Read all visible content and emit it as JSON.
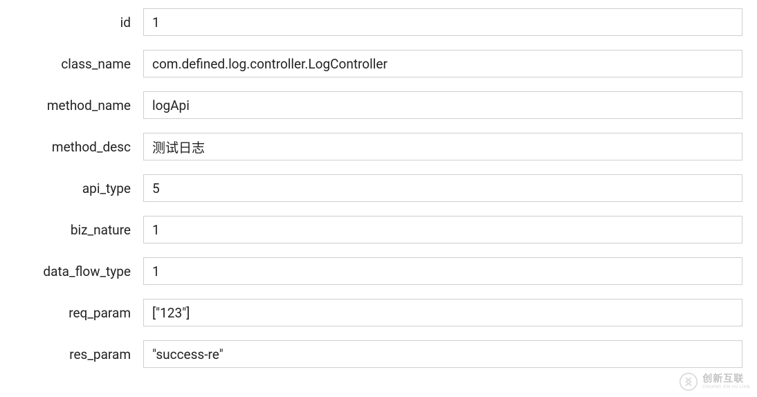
{
  "form": {
    "fields": [
      {
        "label": "id",
        "value": "1"
      },
      {
        "label": "class_name",
        "value": "com.defined.log.controller.LogController"
      },
      {
        "label": "method_name",
        "value": "logApi"
      },
      {
        "label": "method_desc",
        "value": "测试日志"
      },
      {
        "label": "api_type",
        "value": "5"
      },
      {
        "label": "biz_nature",
        "value": "1"
      },
      {
        "label": "data_flow_type",
        "value": "1"
      },
      {
        "label": "req_param",
        "value": "[\"123\"]"
      },
      {
        "label": "res_param",
        "value": "\"success-re\""
      }
    ]
  },
  "watermark": {
    "main": "创新互联",
    "sub": "CHUANG XIN HU LIAN"
  }
}
